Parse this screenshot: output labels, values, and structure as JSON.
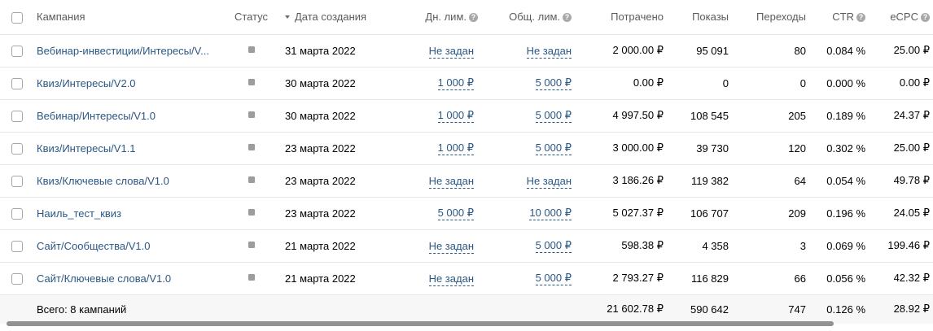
{
  "header": {
    "campaign": "Кампания",
    "status": "Статус",
    "created": "Дата создания",
    "day_limit": "Дн. лим.",
    "total_limit": "Общ. лим.",
    "spent": "Потрачено",
    "impressions": "Показы",
    "clicks": "Переходы",
    "ctr": "CTR",
    "ecpc": "eCPC"
  },
  "rows": [
    {
      "name": "Вебинар-инвестиции/Интересы/V...",
      "date": "31 марта 2022",
      "day_limit": "Не задан",
      "total_limit": "Не задан",
      "spent": "2 000.00 ₽",
      "impressions": "95 091",
      "clicks": "80",
      "ctr": "0.084 %",
      "ecpc": "25.00 ₽"
    },
    {
      "name": "Квиз/Интересы/V2.0",
      "date": "30 марта 2022",
      "day_limit": "1 000 ₽",
      "total_limit": "5 000 ₽",
      "spent": "0.00 ₽",
      "impressions": "0",
      "clicks": "0",
      "ctr": "0.000 %",
      "ecpc": "0.00 ₽"
    },
    {
      "name": "Вебинар/Интересы/V1.0",
      "date": "30 марта 2022",
      "day_limit": "1 000 ₽",
      "total_limit": "5 000 ₽",
      "spent": "4 997.50 ₽",
      "impressions": "108 545",
      "clicks": "205",
      "ctr": "0.189 %",
      "ecpc": "24.37 ₽"
    },
    {
      "name": "Квиз/Интересы/V1.1",
      "date": "23 марта 2022",
      "day_limit": "1 000 ₽",
      "total_limit": "5 000 ₽",
      "spent": "3 000.00 ₽",
      "impressions": "39 730",
      "clicks": "120",
      "ctr": "0.302 %",
      "ecpc": "25.00 ₽"
    },
    {
      "name": "Квиз/Ключевые слова/V1.0",
      "date": "23 марта 2022",
      "day_limit": "Не задан",
      "total_limit": "Не задан",
      "spent": "3 186.26 ₽",
      "impressions": "119 382",
      "clicks": "64",
      "ctr": "0.054 %",
      "ecpc": "49.78 ₽"
    },
    {
      "name": "Наиль_тест_квиз",
      "date": "23 марта 2022",
      "day_limit": "5 000 ₽",
      "total_limit": "10 000 ₽",
      "spent": "5 027.37 ₽",
      "impressions": "106 707",
      "clicks": "209",
      "ctr": "0.196 %",
      "ecpc": "24.05 ₽"
    },
    {
      "name": "Сайт/Сообщества/V1.0",
      "date": "21 марта 2022",
      "day_limit": "Не задан",
      "total_limit": "5 000 ₽",
      "spent": "598.38 ₽",
      "impressions": "4 358",
      "clicks": "3",
      "ctr": "0.069 %",
      "ecpc": "199.46 ₽"
    },
    {
      "name": "Сайт/Ключевые слова/V1.0",
      "date": "21 марта 2022",
      "day_limit": "Не задан",
      "total_limit": "5 000 ₽",
      "spent": "2 793.27 ₽",
      "impressions": "116 829",
      "clicks": "66",
      "ctr": "0.056 %",
      "ecpc": "42.32 ₽"
    }
  ],
  "total": {
    "label": "Всего: 8 кампаний",
    "spent": "21 602.78 ₽",
    "impressions": "590 642",
    "clicks": "747",
    "ctr": "0.126 %",
    "ecpc": "28.92 ₽"
  },
  "icons": {
    "help": "?"
  },
  "colors": {
    "link": "#2a5885",
    "status_idle": "#9d9d9d"
  }
}
